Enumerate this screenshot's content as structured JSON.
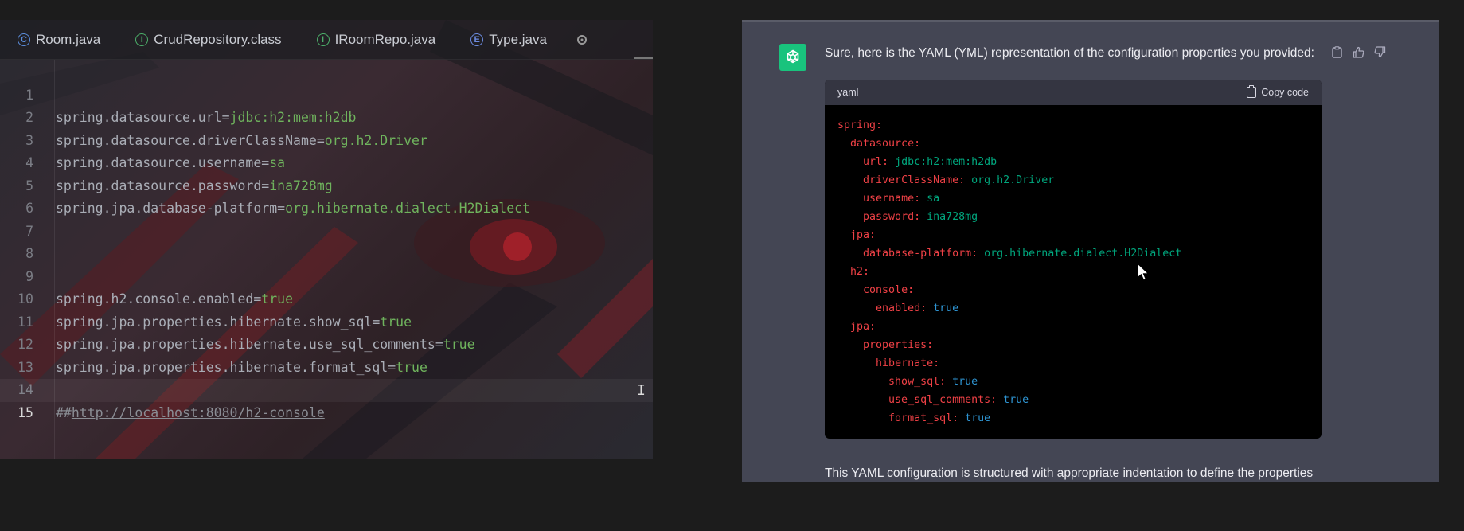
{
  "ide": {
    "tabs": [
      {
        "label": "Room.java",
        "icon": "class-icon",
        "glyph": "C"
      },
      {
        "label": "CrudRepository.class",
        "icon": "interface-icon",
        "glyph": "I"
      },
      {
        "label": "IRoomRepo.java",
        "icon": "interface-icon",
        "glyph": "I"
      },
      {
        "label": "Type.java",
        "icon": "enum-icon",
        "glyph": "E"
      }
    ],
    "lines": [
      {
        "num": "1",
        "key": "spring.datasource.url=",
        "value": "jdbc:h2:mem:h2db"
      },
      {
        "num": "2",
        "key": "spring.datasource.driverClassName=",
        "value": "org.h2.Driver"
      },
      {
        "num": "3",
        "key": "spring.datasource.username=",
        "value": "sa"
      },
      {
        "num": "4",
        "key": "spring.datasource.password=",
        "value": "ina728mg"
      },
      {
        "num": "5",
        "key": "spring.jpa.database-platform=",
        "value": "org.hibernate.dialect.H2Dialect"
      },
      {
        "num": "6",
        "key": "",
        "value": ""
      },
      {
        "num": "7",
        "key": "",
        "value": ""
      },
      {
        "num": "8",
        "key": "",
        "value": ""
      },
      {
        "num": "9",
        "key": "spring.h2.console.enabled=",
        "value": "true"
      },
      {
        "num": "10",
        "key": "spring.jpa.properties.hibernate.show_sql=",
        "value": "true"
      },
      {
        "num": "11",
        "key": "spring.jpa.properties.hibernate.use_sql_comments=",
        "value": "true"
      },
      {
        "num": "12",
        "key": "spring.jpa.properties.hibernate.format_sql=",
        "value": "true"
      },
      {
        "num": "13",
        "key": "",
        "value": ""
      },
      {
        "num": "14",
        "comment": "##",
        "url": "http://localhost:8080/h2-console"
      },
      {
        "num": "15",
        "key": "",
        "value": ""
      }
    ]
  },
  "chat": {
    "intro": "Sure, here is the YAML (YML) representation of the configuration properties you provided:",
    "code_lang": "yaml",
    "copy_label": "Copy code",
    "yaml_lines": [
      {
        "indent": 0,
        "key": "spring:",
        "value": "",
        "vtype": ""
      },
      {
        "indent": 1,
        "key": "datasource:",
        "value": "",
        "vtype": ""
      },
      {
        "indent": 2,
        "key": "url:",
        "value": "jdbc:h2:mem:h2db",
        "vtype": "s"
      },
      {
        "indent": 2,
        "key": "driverClassName:",
        "value": "org.h2.Driver",
        "vtype": "s"
      },
      {
        "indent": 2,
        "key": "username:",
        "value": "sa",
        "vtype": "s"
      },
      {
        "indent": 2,
        "key": "password:",
        "value": "ina728mg",
        "vtype": "s"
      },
      {
        "indent": 1,
        "key": "jpa:",
        "value": "",
        "vtype": ""
      },
      {
        "indent": 2,
        "key": "database-platform:",
        "value": "org.hibernate.dialect.H2Dialect",
        "vtype": "s"
      },
      {
        "indent": 1,
        "key": "h2:",
        "value": "",
        "vtype": ""
      },
      {
        "indent": 2,
        "key": "console:",
        "value": "",
        "vtype": ""
      },
      {
        "indent": 3,
        "key": "enabled:",
        "value": "true",
        "vtype": "b"
      },
      {
        "indent": 1,
        "key": "jpa:",
        "value": "",
        "vtype": ""
      },
      {
        "indent": 2,
        "key": "properties:",
        "value": "",
        "vtype": ""
      },
      {
        "indent": 3,
        "key": "hibernate:",
        "value": "",
        "vtype": ""
      },
      {
        "indent": 4,
        "key": "show_sql:",
        "value": "true",
        "vtype": "b"
      },
      {
        "indent": 4,
        "key": "use_sql_comments:",
        "value": "true",
        "vtype": "b"
      },
      {
        "indent": 4,
        "key": "format_sql:",
        "value": "true",
        "vtype": "b"
      }
    ],
    "outro": "This YAML configuration is structured with appropriate indentation to define the properties"
  }
}
